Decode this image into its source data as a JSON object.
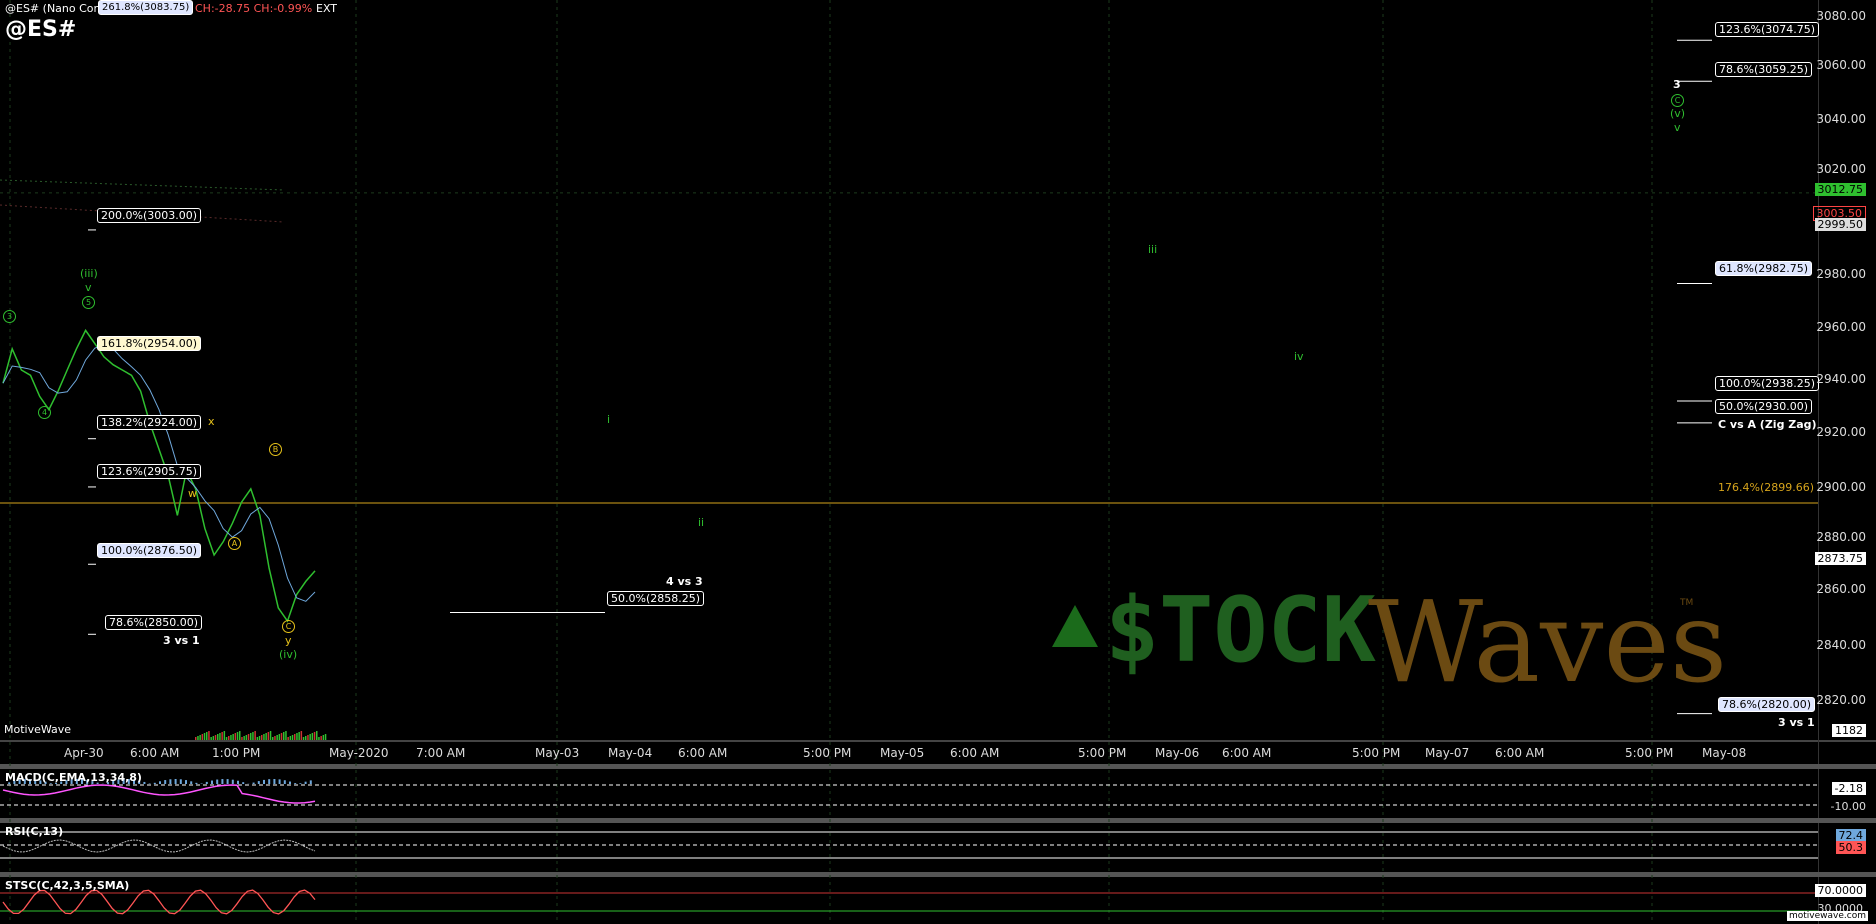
{
  "header": {
    "symbol_line": "@ES# (Nano Contract) - 5 Min",
    "fib_hidden": "261.8%(3083.75)",
    "change_text": "CH:-28.75  CH:-0.99%",
    "ext": "EXT",
    "symbol": "@ES#"
  },
  "watermark": "MotiveWave",
  "footer_url": "motivewave.com",
  "logo": {
    "stock": "$TOCK",
    "waves": "Waves",
    "tm": "TM"
  },
  "colors": {
    "background": "#000000",
    "grid": "#1d3a1d",
    "price": "#2fbf2f",
    "wave_yellow": "#e6c21a",
    "orange_line": "#d6a41c",
    "macd_line": "#ff55ff",
    "macd_hist": "#6fa8dc",
    "rsi_line": "#bbbbbb",
    "stoch_line": "#ff5555"
  },
  "fibs": [
    {
      "text": "123.6%(3074.75)",
      "style": "plain"
    },
    {
      "text": "78.6%(3059.25)",
      "style": "plain"
    },
    {
      "text": "200.0%(3003.00)",
      "style": "plain"
    },
    {
      "text": "61.8%(2982.75)",
      "style": "blue"
    },
    {
      "text": "161.8%(2954.00)",
      "style": "yellow"
    },
    {
      "text": "100.0%(2938.25)",
      "style": "plain"
    },
    {
      "text": "50.0%(2930.00)",
      "style": "plain"
    },
    {
      "text": "138.2%(2924.00)",
      "style": "plain"
    },
    {
      "text": "123.6%(2905.75)",
      "style": "plain"
    },
    {
      "text": "100.0%(2876.50)",
      "style": "blue"
    },
    {
      "text": "50.0%(2858.25)",
      "style": "plain"
    },
    {
      "text": "78.6%(2850.00)",
      "style": "plain"
    },
    {
      "text": "78.6%(2820.00)",
      "style": "blue"
    }
  ],
  "annotations": {
    "c_vs_a": "C vs A (Zig Zag)",
    "four_vs_three": "4 vs 3",
    "three_vs_one_left": "3 vs 1",
    "three_vs_one_right": "3 vs 1",
    "orange_level": "176.4%(2899.66)"
  },
  "wave_labels": {
    "iii_top": "(iii)",
    "v_small": "v",
    "five_circ": "5",
    "three_circ": "3",
    "four_circ": "4",
    "x": "x",
    "w": "w",
    "B": "B",
    "A": "A",
    "C": "C",
    "y": "y",
    "iv_paren": "(iv)",
    "i": "i",
    "ii": "ii",
    "iii": "iii",
    "iv": "iv",
    "r3": "3",
    "rC": "C",
    "rv_paren": "(v)",
    "rv": "v"
  },
  "price_axis": {
    "ticks": [
      "3080.00",
      "3060.00",
      "3040.00",
      "3020.00",
      "2980.00",
      "2960.00",
      "2940.00",
      "2920.00",
      "2900.00",
      "2880.00",
      "2860.00",
      "2840.00",
      "2820.00"
    ],
    "badges": [
      {
        "text": "3012.75",
        "bg": "#2fbf2f",
        "fg": "#000"
      },
      {
        "text": "3003.50",
        "bg": "#000",
        "fg": "#ff4444"
      },
      {
        "text": "2999.50",
        "bg": "#ddd",
        "fg": "#000"
      },
      {
        "text": "2873.75",
        "bg": "#fff",
        "fg": "#000"
      },
      {
        "text": "1182",
        "bg": "#fff",
        "fg": "#000"
      }
    ]
  },
  "time_axis": [
    "Apr-30",
    "6:00 AM",
    "1:00 PM",
    "May-2020",
    "7:00 AM",
    "May-03",
    "May-04",
    "6:00 AM",
    "5:00 PM",
    "May-05",
    "6:00 AM",
    "5:00 PM",
    "May-06",
    "6:00 AM",
    "5:00 PM",
    "May-07",
    "6:00 AM",
    "5:00 PM",
    "May-08"
  ],
  "indicators": {
    "macd": {
      "title": "MACD(C,EMA,13,34,8)",
      "ticks": [
        "-2.18",
        "-10.00"
      ]
    },
    "rsi": {
      "title": "RSI(C,13)",
      "ticks": [
        "72.4",
        "50.3"
      ]
    },
    "stoch": {
      "title": "STSC(C,42,3,5,SMA)",
      "ticks": [
        "70.0000",
        "30.0000"
      ]
    }
  },
  "chart_data": {
    "type": "line",
    "title": "@ES#",
    "ylim": [
      2810,
      3090
    ],
    "series": [
      {
        "values": [
          2945,
          2958,
          2950,
          2948,
          2940,
          2935,
          2942,
          2950,
          2958,
          2965,
          2960,
          2955,
          2952,
          2950,
          2948,
          2942,
          2930,
          2920,
          2910,
          2895,
          2912,
          2905,
          2890,
          2880,
          2885,
          2892,
          2900,
          2905,
          2895,
          2875,
          2860,
          2855,
          2865,
          2870,
          2874
        ]
      }
    ]
  }
}
